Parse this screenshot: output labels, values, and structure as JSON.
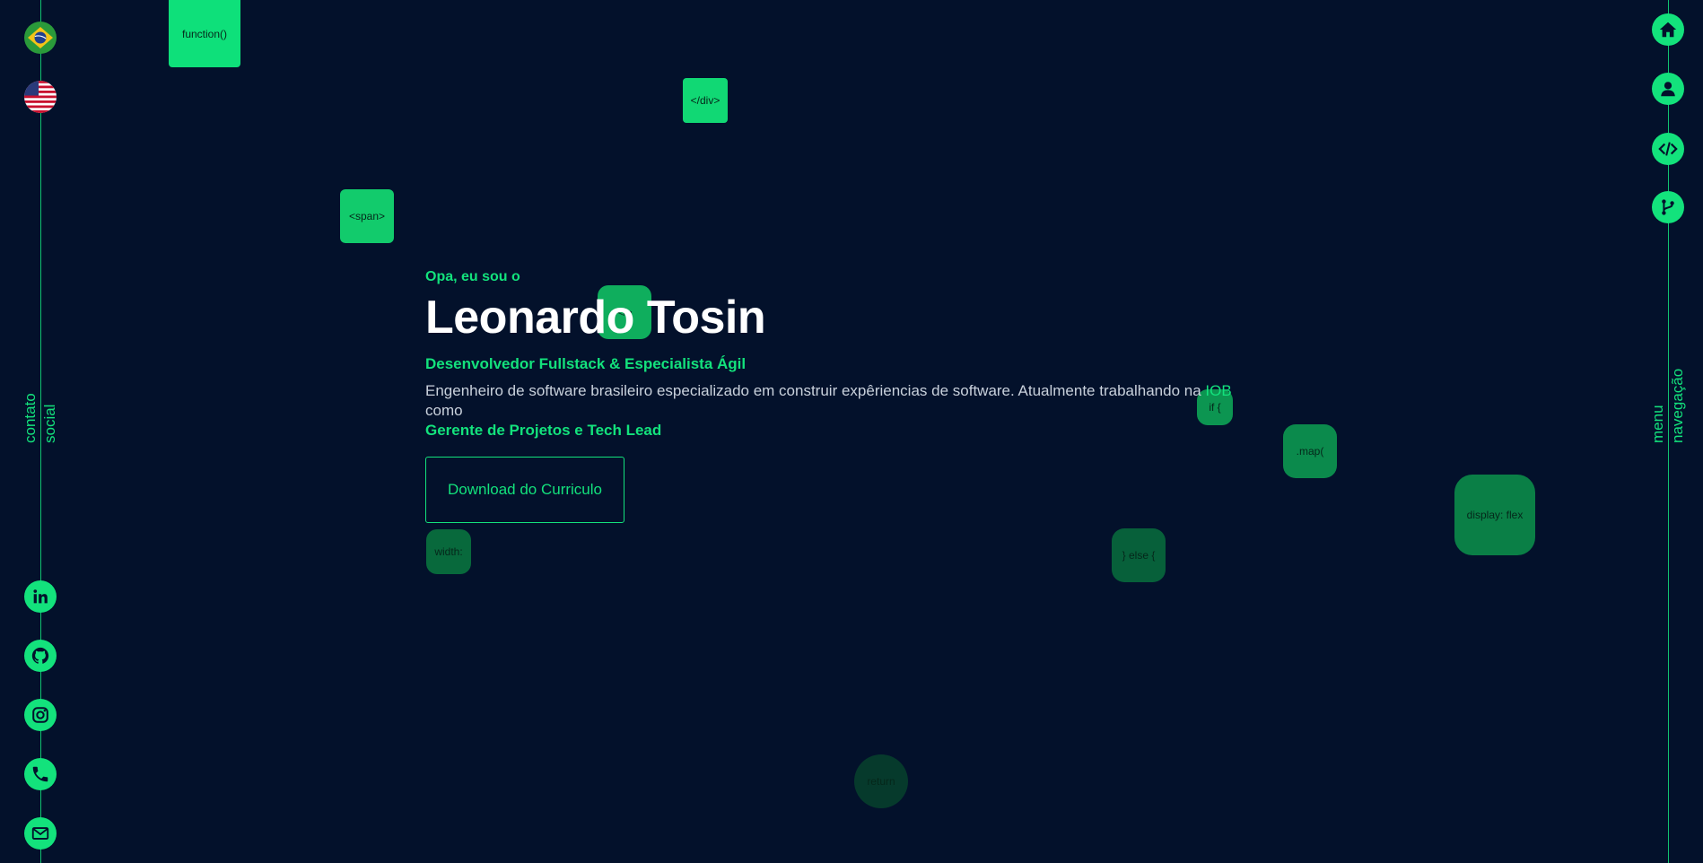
{
  "languages": [
    {
      "name": "Português (Brasil)",
      "icon": "brazil-flag-icon"
    },
    {
      "name": "English",
      "icon": "usa-flag-icon"
    }
  ],
  "left_nav": {
    "label_line1": "contato",
    "label_line2": "social"
  },
  "right_nav": {
    "label_line1": "menu",
    "label_line2": "navegação"
  },
  "social_icons": [
    "linkedin-icon",
    "github-icon",
    "instagram-icon",
    "phone-icon",
    "mail-icon"
  ],
  "menu_icons": [
    "home-icon",
    "user-icon",
    "code-icon",
    "git-branch-icon"
  ],
  "code_chips": {
    "function": "function()",
    "div": "</div>",
    "span": "<span>",
    "tag": "</>",
    "if": "if {",
    "map": ".map(",
    "display": "display: flex",
    "width": "width:",
    "else": "} else {",
    "return": "return"
  },
  "hero": {
    "greeting": "Opa, eu sou o",
    "name": "Leonardo Tosin",
    "role": "Desenvolvedor Fullstack & Especialista Ágil",
    "desc_part1": "Engenheiro de software brasileiro especializado em construir expêriencias de software. Atualmente trabalhando na ",
    "company": "IOB",
    "desc_part2": " como",
    "position": "Gerente de Projetos e Tech Lead",
    "cv_button": "Download do Curriculo"
  },
  "colors": {
    "background": "#03112b",
    "accent": "#13e27c",
    "text": "#c9d1dc",
    "heading": "#ffffff"
  }
}
